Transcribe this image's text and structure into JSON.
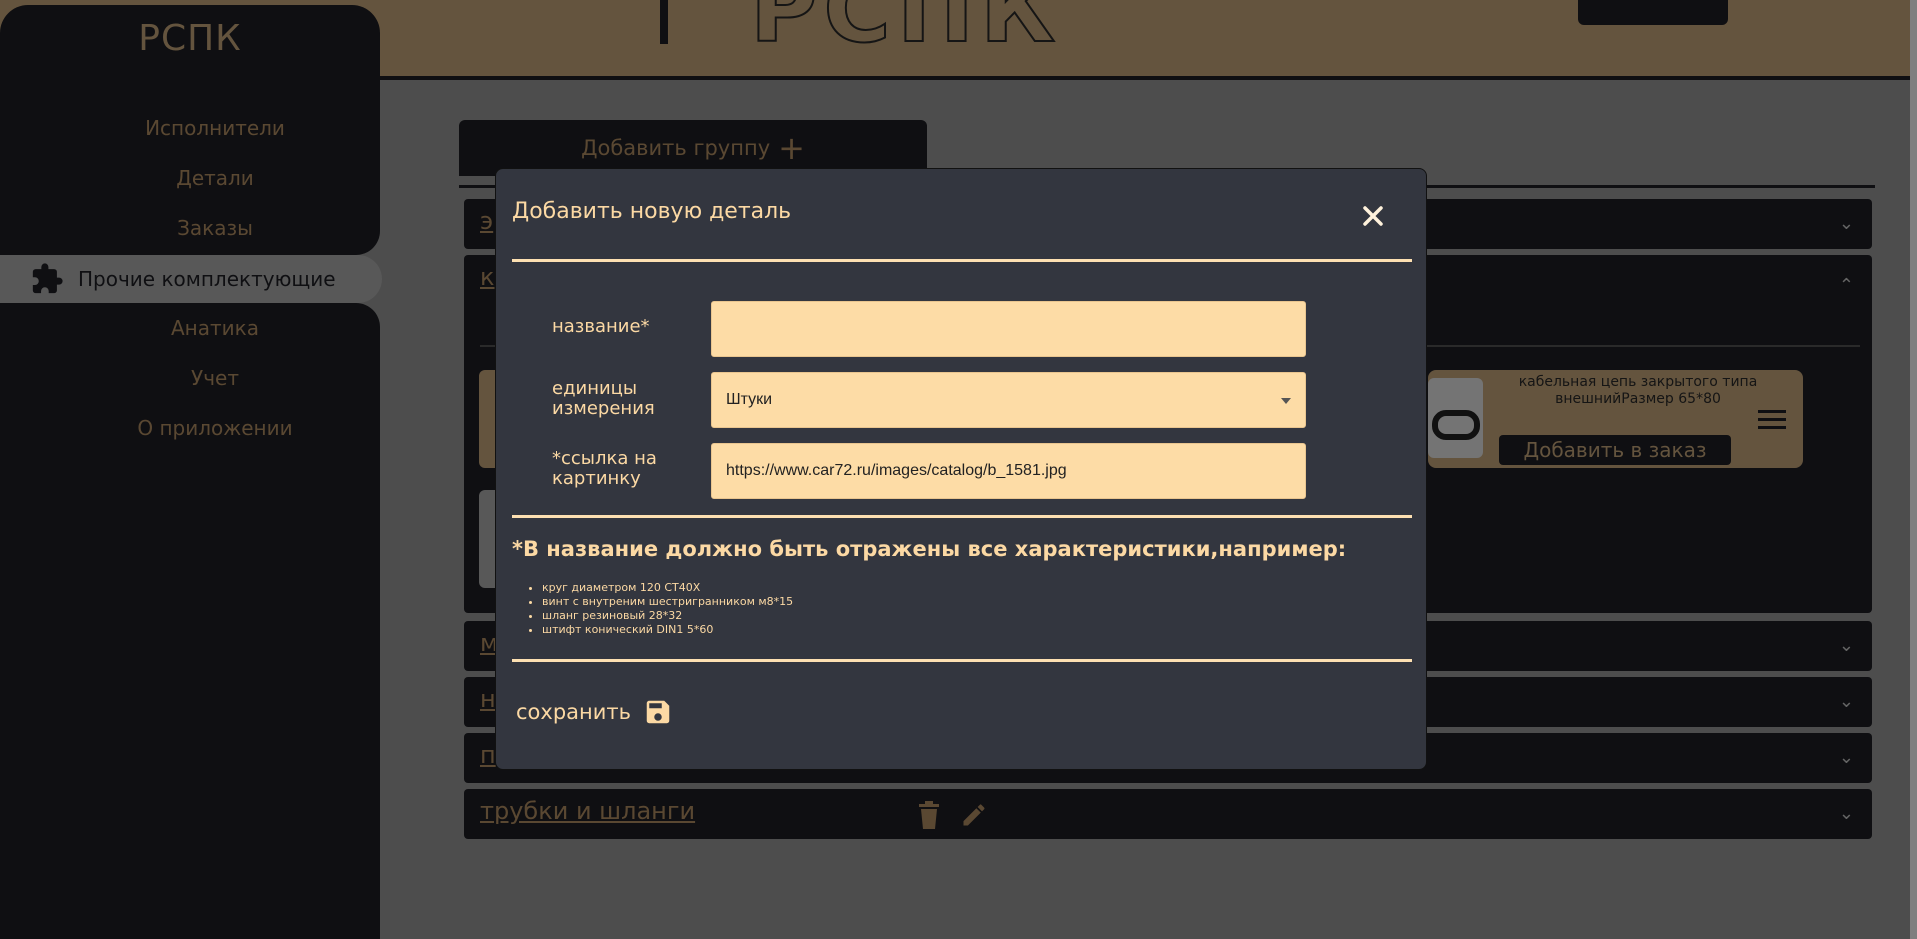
{
  "header": {
    "brand": "РСПК"
  },
  "sidebar": {
    "items": [
      {
        "label": "Исполнители"
      },
      {
        "label": "Детали"
      },
      {
        "label": "Заказы"
      },
      {
        "label": "Прочие комплектующие",
        "active": true,
        "icon": "puzzle-icon"
      },
      {
        "label": "Анатика"
      },
      {
        "label": "Учет"
      },
      {
        "label": "О приложении"
      }
    ]
  },
  "main": {
    "add_group_label": "Добавить группу",
    "groups": [
      {
        "title": "э"
      },
      {
        "title": "к"
      },
      {
        "title": "м"
      },
      {
        "title": "н"
      },
      {
        "title": "п"
      },
      {
        "title": "трубки и шланги"
      }
    ],
    "card": {
      "title": "кабельная цепь закрытого типа внешнийРазмер 65*80",
      "order_button": "Добавить в заказ"
    }
  },
  "modal": {
    "title": "Добавить новую деталь",
    "fields": {
      "name_label": "название*",
      "name_value": "",
      "units_label_line1": "единицы",
      "units_label_line2": "измерения",
      "units_value": "Штуки",
      "image_label_line1": "*ссылка на",
      "image_label_line2": "картинку",
      "image_value": "https://www.car72.ru/images/catalog/b_1581.jpg"
    },
    "hint_title": "*В название должно быть отражены все характеристики,например:",
    "hint_examples": [
      "круг диаметром 120 СТ40Х",
      "винт с внутреним шестригранником м8*15",
      "шланг резиновый 28*32",
      "штифт конический DIN1 5*60"
    ],
    "save_label": "сохранить"
  },
  "colors": {
    "dark": "#1e1f25",
    "gold": "#c9a87c",
    "modal_bg": "#33363f",
    "modal_text": "#fcd9a4",
    "input_bg": "#fddca6"
  }
}
